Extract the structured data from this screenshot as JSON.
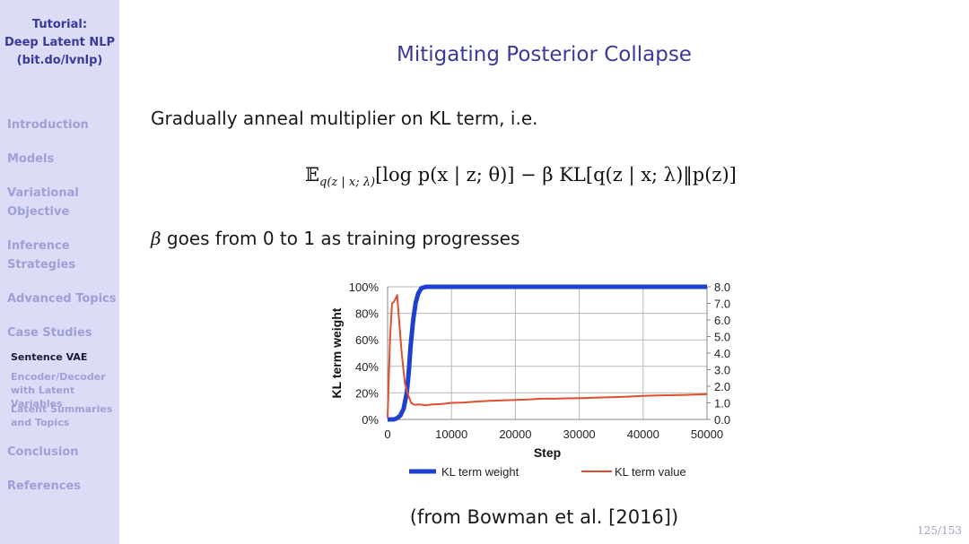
{
  "sidebar": {
    "title_lines": [
      "Tutorial:",
      "Deep Latent NLP",
      "(bit.do/lvnlp)"
    ],
    "sections": [
      {
        "label_lines": [
          "Introduction"
        ]
      },
      {
        "label_lines": [
          "Models"
        ]
      },
      {
        "label_lines": [
          "Variational",
          "Objective"
        ]
      },
      {
        "label_lines": [
          "Inference",
          "Strategies"
        ]
      },
      {
        "label_lines": [
          "Advanced Topics"
        ]
      },
      {
        "label_lines": [
          "Case Studies"
        ]
      },
      {
        "label_lines": [
          "Conclusion"
        ]
      },
      {
        "label_lines": [
          "References"
        ]
      }
    ],
    "subsections": [
      {
        "label_lines": [
          "Sentence VAE"
        ],
        "active": true
      },
      {
        "label_lines": [
          "Encoder/Decoder",
          "with Latent Variables"
        ],
        "active": false
      },
      {
        "label_lines": [
          "Latent Summaries",
          "and Topics"
        ],
        "active": false
      }
    ]
  },
  "slide": {
    "title": "Mitigating Posterior Collapse",
    "line1": "Gradually anneal multiplier on KL term, i.e.",
    "formula": {
      "E": "𝔼",
      "sub": "q(z | x; λ)",
      "rest": "[log p(x | z; θ)] − β KL[q(z | x; λ)‖p(z)]"
    },
    "beta_symbol": "β",
    "line2": "goes from 0 to 1 as training progresses",
    "citation": "(from Bowman et al. [2016])",
    "page_number": "125/153"
  },
  "chart_data": {
    "type": "line",
    "title": "",
    "xlabel": "Step",
    "ylabel_left": "KL term weight",
    "ylabel_right": "KL term value",
    "xlim": [
      0,
      50000
    ],
    "ylim_left": [
      0,
      100
    ],
    "ylim_right": [
      0,
      8.0
    ],
    "x_ticks": [
      "0",
      "10000",
      "20000",
      "30000",
      "40000",
      "50000"
    ],
    "y_ticks_left": [
      "0%",
      "20%",
      "40%",
      "60%",
      "80%",
      "100%"
    ],
    "y_ticks_right": [
      "0.0",
      "1.0",
      "2.0",
      "3.0",
      "4.0",
      "5.0",
      "6.0",
      "7.0",
      "8.0"
    ],
    "grid": true,
    "legend_position": "bottom",
    "series": [
      {
        "name": "KL term weight",
        "axis": "left",
        "color": "#1f3fd0",
        "x": [
          0,
          1000,
          1500,
          2000,
          2500,
          3000,
          3300,
          3600,
          4000,
          4400,
          4800,
          5300,
          6000,
          10000,
          20000,
          30000,
          40000,
          50000
        ],
        "y": [
          0,
          0,
          1,
          3,
          8,
          20,
          35,
          55,
          75,
          88,
          95,
          99,
          100,
          100,
          100,
          100,
          100,
          100
        ]
      },
      {
        "name": "KL term value",
        "axis": "right",
        "color": "#e05030",
        "x": [
          0,
          400,
          700,
          1000,
          1500,
          1800,
          2200,
          2700,
          3200,
          3700,
          4200,
          5000,
          6000,
          7000,
          8000,
          9000,
          10000,
          12000,
          14000,
          16000,
          18000,
          20000,
          22000,
          24000,
          26000,
          28000,
          30000,
          32000,
          34000,
          36000,
          38000,
          40000,
          42000,
          44000,
          46000,
          48000,
          50000
        ],
        "y": [
          0.1,
          5.0,
          7.0,
          7.1,
          7.5,
          6.0,
          4.0,
          2.2,
          1.5,
          1.0,
          0.88,
          0.9,
          0.85,
          0.9,
          0.92,
          0.95,
          1.0,
          1.02,
          1.08,
          1.12,
          1.15,
          1.18,
          1.2,
          1.25,
          1.25,
          1.27,
          1.28,
          1.3,
          1.33,
          1.35,
          1.38,
          1.42,
          1.45,
          1.46,
          1.47,
          1.5,
          1.52
        ]
      }
    ]
  }
}
